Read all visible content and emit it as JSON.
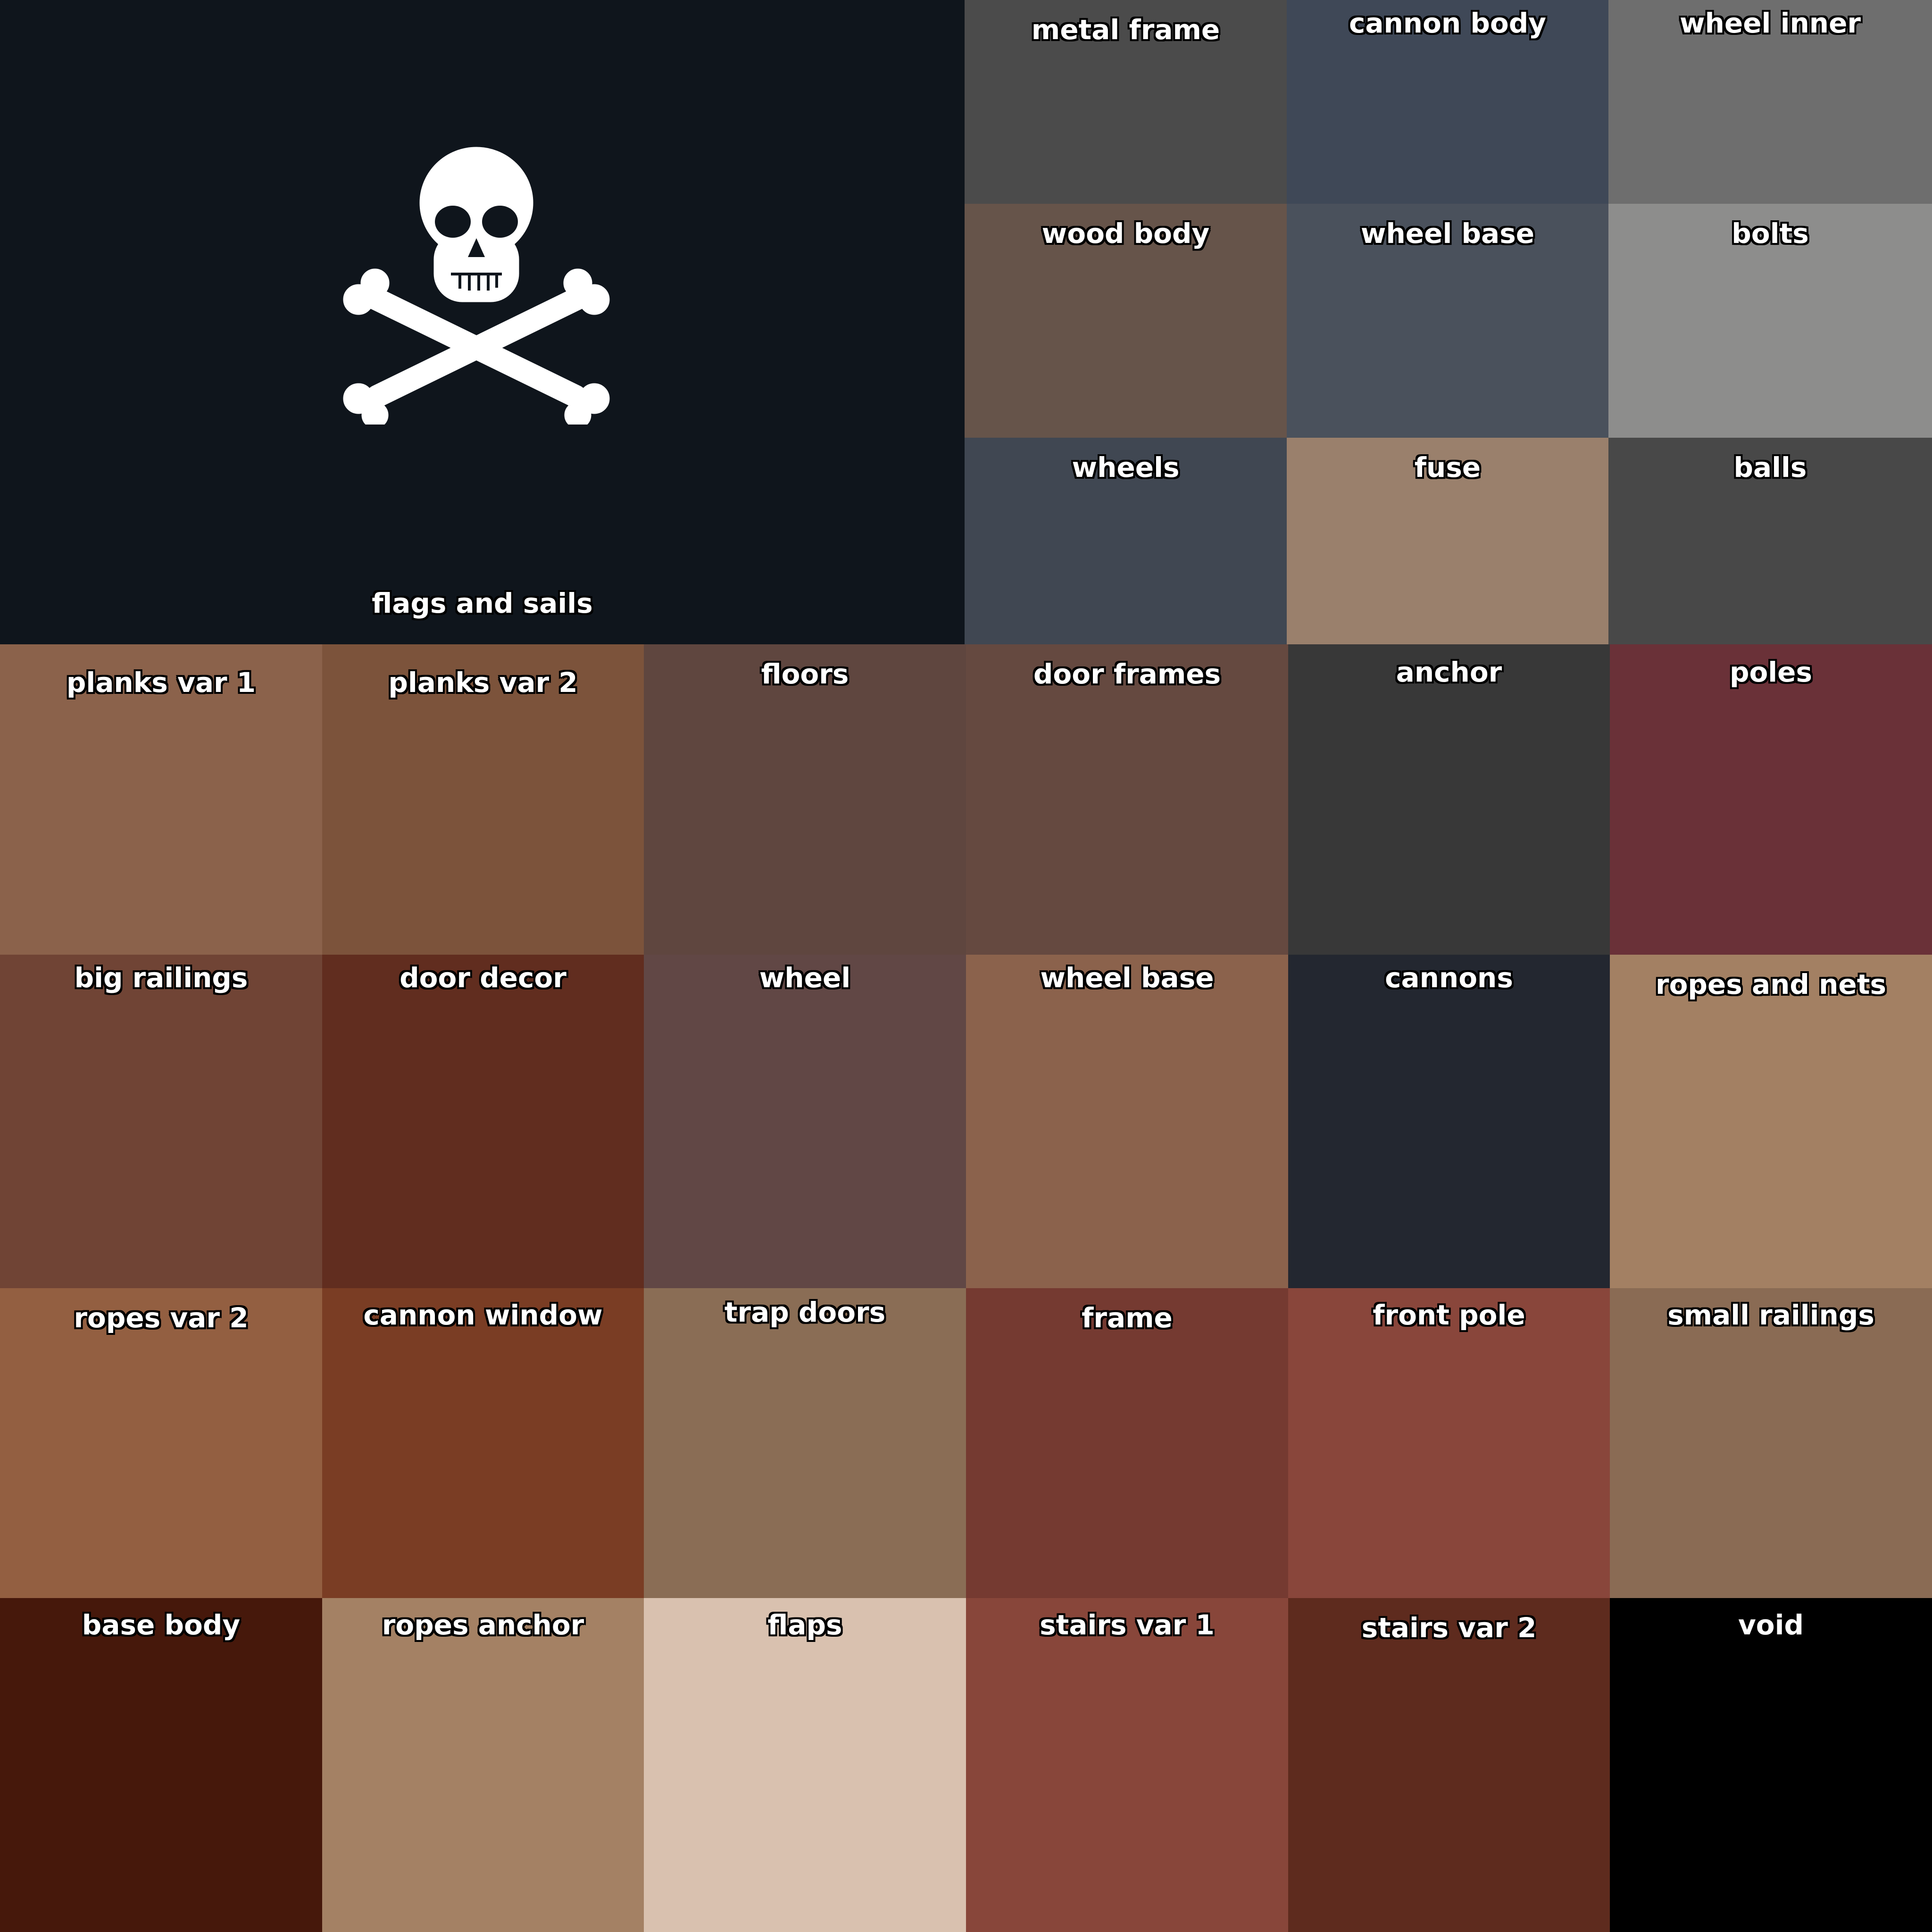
{
  "flag": {
    "label": "flags and sails",
    "color": "#0f151c",
    "emblem": "skull-and-crossbones-icon"
  },
  "swatches": [
    {
      "label": "metal frame",
      "color": "#4b4b4b"
    },
    {
      "label": "cannon body",
      "color": "#3f4857"
    },
    {
      "label": "wheel inner",
      "color": "#6e6e6e"
    },
    {
      "label": "wood body",
      "color": "#66544a"
    },
    {
      "label": "wheel base",
      "color": "#4a515c"
    },
    {
      "label": "bolts",
      "color": "#8d8d8c"
    },
    {
      "label": "wheels",
      "color": "#404752"
    },
    {
      "label": "fuse",
      "color": "#9a806c"
    },
    {
      "label": "balls",
      "color": "#484848"
    },
    {
      "label": "planks var 1",
      "color": "#8b624b"
    },
    {
      "label": "planks var 2",
      "color": "#7c533b"
    },
    {
      "label": "floors",
      "color": "#5f463f"
    },
    {
      "label": "door frames",
      "color": "#654940"
    },
    {
      "label": "anchor",
      "color": "#383838"
    },
    {
      "label": "poles",
      "color": "#6a3138"
    },
    {
      "label": "big railings",
      "color": "#704435"
    },
    {
      "label": "door decor",
      "color": "#612d1f"
    },
    {
      "label": "wheel",
      "color": "#614745"
    },
    {
      "label": "wheel base",
      "color": "#8b624c"
    },
    {
      "label": "cannons",
      "color": "#232730"
    },
    {
      "label": "ropes and nets",
      "color": "#a38063"
    },
    {
      "label": "ropes var 2",
      "color": "#935f41"
    },
    {
      "label": "cannon window",
      "color": "#7a3d24"
    },
    {
      "label": "trap doors",
      "color": "#8a6d55"
    },
    {
      "label": "frame",
      "color": "#753a31"
    },
    {
      "label": "front pole",
      "color": "#89463b"
    },
    {
      "label": "small railings",
      "color": "#8a6b54"
    },
    {
      "label": "base body",
      "color": "#46180b"
    },
    {
      "label": "ropes anchor",
      "color": "#a48164"
    },
    {
      "label": "flaps",
      "color": "#d9c1af"
    },
    {
      "label": "stairs var 1",
      "color": "#88463a"
    },
    {
      "label": "stairs var 2",
      "color": "#5e2b1e"
    },
    {
      "label": "void",
      "color": "#000000"
    }
  ]
}
